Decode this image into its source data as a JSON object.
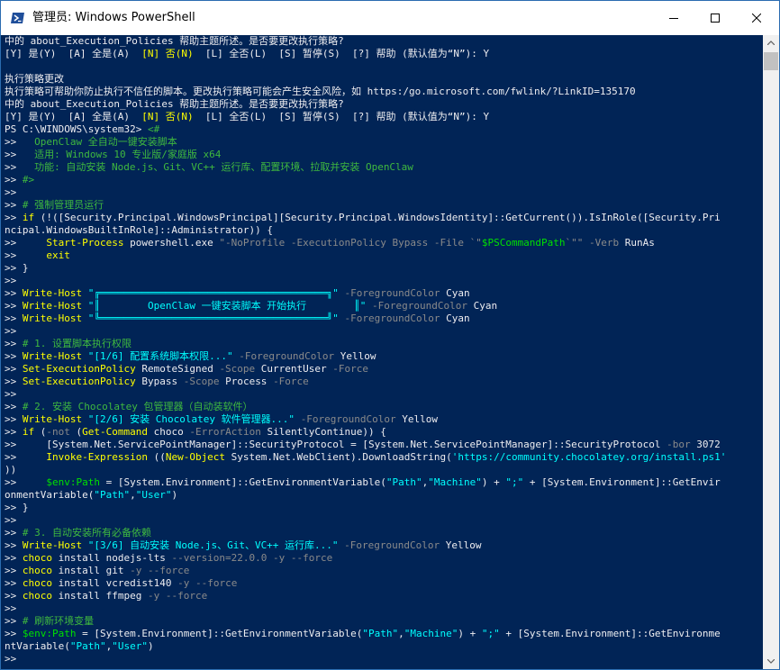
{
  "window": {
    "title": "管理员: Windows PowerShell",
    "app_icon": "powershell-icon",
    "buttons": [
      "minimize-icon",
      "maximize-icon",
      "close-icon"
    ]
  },
  "colors": {
    "console_bg": "#012456",
    "text": "#eeedf0",
    "cmdlet": "#ffff00",
    "comment": "#3fb93f",
    "param": "#8a8a8a",
    "string": "#00ffff",
    "variable": "#00e000"
  },
  "console": {
    "lines": [
      [
        [
          "w",
          "中的 about_Execution_Policies 帮助主题所述。是否要更改执行策略?"
        ]
      ],
      [
        [
          "w",
          "[Y] 是(Y)  [A] 全是(A)  "
        ],
        [
          "y",
          "[N] 否(N)"
        ],
        [
          "w",
          "  [L] 全否(L)  [S] 暂停(S)  [?] 帮助 (默认值为“N”): Y"
        ]
      ],
      [],
      [
        [
          "w",
          "执行策略更改"
        ]
      ],
      [
        [
          "w",
          "执行策略可帮助你防止执行不信任的脚本。更改执行策略可能会产生安全风险，如 https:/go.microsoft.com/fwlink/?LinkID=135170"
        ]
      ],
      [
        [
          "w",
          "中的 about_Execution_Policies 帮助主题所述。是否要更改执行策略?"
        ]
      ],
      [
        [
          "w",
          "[Y] 是(Y)  [A] 全是(A)  "
        ],
        [
          "y",
          "[N] 否(N)"
        ],
        [
          "w",
          "  [L] 全否(L)  [S] 暂停(S)  [?] 帮助 (默认值为“N”): Y"
        ]
      ],
      [
        [
          "w",
          "PS C:\\WINDOWS\\system32> "
        ],
        [
          "g",
          "<#"
        ]
      ],
      [
        [
          "w",
          ">> "
        ],
        [
          "g",
          "  OpenClaw 全自动一键安装脚本"
        ]
      ],
      [
        [
          "w",
          ">> "
        ],
        [
          "g",
          "  适用: Windows 10 专业版/家庭版 x64"
        ]
      ],
      [
        [
          "w",
          ">> "
        ],
        [
          "g",
          "  功能: 自动安装 Node.js、Git、VC++ 运行库、配置环境、拉取并安装 OpenClaw"
        ]
      ],
      [
        [
          "w",
          ">> "
        ],
        [
          "g",
          "#>"
        ]
      ],
      [
        [
          "w",
          ">>"
        ]
      ],
      [
        [
          "w",
          ">> "
        ],
        [
          "g",
          "# 强制管理员运行"
        ]
      ],
      [
        [
          "w",
          ">> "
        ],
        [
          "y",
          "if"
        ],
        [
          "w",
          " (!([Security.Principal.WindowsPrincipal][Security.Principal.WindowsIdentity]::GetCurrent()).IsInRole([Security.Pri"
        ]
      ],
      [
        [
          "w",
          "ncipal.WindowsBuiltInRole]::Administrator)) {"
        ]
      ],
      [
        [
          "w",
          ">>     "
        ],
        [
          "y",
          "Start-Process"
        ],
        [
          "w",
          " powershell.exe "
        ],
        [
          "gr",
          "\"-NoProfile -ExecutionPolicy Bypass -File `\""
        ],
        [
          "gn",
          "$PSCommandPath"
        ],
        [
          "gr",
          "`\"\""
        ],
        [
          "w",
          " "
        ],
        [
          "gr",
          "-Verb"
        ],
        [
          "w",
          " RunAs"
        ]
      ],
      [
        [
          "w",
          ">>     "
        ],
        [
          "y",
          "exit"
        ]
      ],
      [
        [
          "w",
          ">> }"
        ]
      ],
      [
        [
          "w",
          ">>"
        ]
      ],
      [
        [
          "w",
          ">> "
        ],
        [
          "y",
          "Write-Host"
        ],
        [
          "w",
          " "
        ],
        [
          "c",
          "\"╔══════════════════════════════════════╗\""
        ],
        [
          "w",
          " "
        ],
        [
          "gr",
          "-ForegroundColor"
        ],
        [
          "w",
          " Cyan"
        ]
      ],
      [
        [
          "w",
          ">> "
        ],
        [
          "y",
          "Write-Host"
        ],
        [
          "w",
          " "
        ],
        [
          "c",
          "\"║        OpenClaw 一键安装脚本 开始执行        ║\""
        ],
        [
          "w",
          " "
        ],
        [
          "gr",
          "-ForegroundColor"
        ],
        [
          "w",
          " Cyan"
        ]
      ],
      [
        [
          "w",
          ">> "
        ],
        [
          "y",
          "Write-Host"
        ],
        [
          "w",
          " "
        ],
        [
          "c",
          "\"╚══════════════════════════════════════╝\""
        ],
        [
          "w",
          " "
        ],
        [
          "gr",
          "-ForegroundColor"
        ],
        [
          "w",
          " Cyan"
        ]
      ],
      [
        [
          "w",
          ">>"
        ]
      ],
      [
        [
          "w",
          ">> "
        ],
        [
          "g",
          "# 1. 设置脚本执行权限"
        ]
      ],
      [
        [
          "w",
          ">> "
        ],
        [
          "y",
          "Write-Host"
        ],
        [
          "w",
          " "
        ],
        [
          "c",
          "\"[1/6] 配置系统脚本权限...\""
        ],
        [
          "w",
          " "
        ],
        [
          "gr",
          "-ForegroundColor"
        ],
        [
          "w",
          " Yellow"
        ]
      ],
      [
        [
          "w",
          ">> "
        ],
        [
          "y",
          "Set-ExecutionPolicy"
        ],
        [
          "w",
          " RemoteSigned "
        ],
        [
          "gr",
          "-Scope"
        ],
        [
          "w",
          " CurrentUser "
        ],
        [
          "gr",
          "-Force"
        ]
      ],
      [
        [
          "w",
          ">> "
        ],
        [
          "y",
          "Set-ExecutionPolicy"
        ],
        [
          "w",
          " Bypass "
        ],
        [
          "gr",
          "-Scope"
        ],
        [
          "w",
          " Process "
        ],
        [
          "gr",
          "-Force"
        ]
      ],
      [
        [
          "w",
          ">>"
        ]
      ],
      [
        [
          "w",
          ">> "
        ],
        [
          "g",
          "# 2. 安装 Chocolatey 包管理器（自动装软件）"
        ]
      ],
      [
        [
          "w",
          ">> "
        ],
        [
          "y",
          "Write-Host"
        ],
        [
          "w",
          " "
        ],
        [
          "c",
          "\"[2/6] 安装 Chocolatey 软件管理器...\""
        ],
        [
          "w",
          " "
        ],
        [
          "gr",
          "-ForegroundColor"
        ],
        [
          "w",
          " Yellow"
        ]
      ],
      [
        [
          "w",
          ">> "
        ],
        [
          "y",
          "if"
        ],
        [
          "w",
          " ("
        ],
        [
          "gr",
          "-not"
        ],
        [
          "w",
          " ("
        ],
        [
          "y",
          "Get-Command"
        ],
        [
          "w",
          " choco "
        ],
        [
          "gr",
          "-ErrorAction"
        ],
        [
          "w",
          " SilentlyContinue)) {"
        ]
      ],
      [
        [
          "w",
          ">>     [System.Net.ServicePointManager]::SecurityProtocol = [System.Net.ServicePointManager]::SecurityProtocol "
        ],
        [
          "gr",
          "-bor"
        ],
        [
          "w",
          " 3072"
        ]
      ],
      [
        [
          "w",
          ">>     "
        ],
        [
          "y",
          "Invoke-Expression"
        ],
        [
          "w",
          " (("
        ],
        [
          "y",
          "New-Object"
        ],
        [
          "w",
          " System.Net.WebClient).DownloadString("
        ],
        [
          "c",
          "'https://community.chocolatey.org/install.ps1'"
        ]
      ],
      [
        [
          "w",
          "))"
        ]
      ],
      [
        [
          "w",
          ">>     "
        ],
        [
          "gn",
          "$env:Path"
        ],
        [
          "w",
          " = [System.Environment]::GetEnvironmentVariable("
        ],
        [
          "c",
          "\"Path\""
        ],
        [
          "w",
          ","
        ],
        [
          "c",
          "\"Machine\""
        ],
        [
          "w",
          ") + "
        ],
        [
          "c",
          "\";\""
        ],
        [
          "w",
          " + [System.Environment]::GetEnvir"
        ]
      ],
      [
        [
          "w",
          "onmentVariable("
        ],
        [
          "c",
          "\"Path\""
        ],
        [
          "w",
          ","
        ],
        [
          "c",
          "\"User\""
        ],
        [
          "w",
          ")"
        ]
      ],
      [
        [
          "w",
          ">> }"
        ]
      ],
      [
        [
          "w",
          ">>"
        ]
      ],
      [
        [
          "w",
          ">> "
        ],
        [
          "g",
          "# 3. 自动安装所有必备依赖"
        ]
      ],
      [
        [
          "w",
          ">> "
        ],
        [
          "y",
          "Write-Host"
        ],
        [
          "w",
          " "
        ],
        [
          "c",
          "\"[3/6] 自动安装 Node.js、Git、VC++ 运行库...\""
        ],
        [
          "w",
          " "
        ],
        [
          "gr",
          "-ForegroundColor"
        ],
        [
          "w",
          " Yellow"
        ]
      ],
      [
        [
          "w",
          ">> "
        ],
        [
          "y",
          "choco"
        ],
        [
          "w",
          " install nodejs-lts "
        ],
        [
          "gr",
          "--version=22.0.0"
        ],
        [
          "w",
          " "
        ],
        [
          "gr",
          "-y"
        ],
        [
          "w",
          " "
        ],
        [
          "gr",
          "--force"
        ]
      ],
      [
        [
          "w",
          ">> "
        ],
        [
          "y",
          "choco"
        ],
        [
          "w",
          " install git "
        ],
        [
          "gr",
          "-y"
        ],
        [
          "w",
          " "
        ],
        [
          "gr",
          "--force"
        ]
      ],
      [
        [
          "w",
          ">> "
        ],
        [
          "y",
          "choco"
        ],
        [
          "w",
          " install vcredist140 "
        ],
        [
          "gr",
          "-y"
        ],
        [
          "w",
          " "
        ],
        [
          "gr",
          "--force"
        ]
      ],
      [
        [
          "w",
          ">> "
        ],
        [
          "y",
          "choco"
        ],
        [
          "w",
          " install ffmpeg "
        ],
        [
          "gr",
          "-y"
        ],
        [
          "w",
          " "
        ],
        [
          "gr",
          "--force"
        ]
      ],
      [
        [
          "w",
          ">>"
        ]
      ],
      [
        [
          "w",
          ">> "
        ],
        [
          "g",
          "# 刷新环境变量"
        ]
      ],
      [
        [
          "w",
          ">> "
        ],
        [
          "gn",
          "$env:Path"
        ],
        [
          "w",
          " = [System.Environment]::GetEnvironmentVariable("
        ],
        [
          "c",
          "\"Path\""
        ],
        [
          "w",
          ","
        ],
        [
          "c",
          "\"Machine\""
        ],
        [
          "w",
          ") + "
        ],
        [
          "c",
          "\";\""
        ],
        [
          "w",
          " + [System.Environment]::GetEnvironme"
        ]
      ],
      [
        [
          "w",
          "ntVariable("
        ],
        [
          "c",
          "\"Path\""
        ],
        [
          "w",
          ","
        ],
        [
          "c",
          "\"User\""
        ],
        [
          "w",
          ")"
        ]
      ],
      [
        [
          "w",
          ">>"
        ]
      ]
    ]
  },
  "scrollbar": {
    "up_icon": "scroll-up-arrow-icon",
    "down_icon": "scroll-down-arrow-icon"
  }
}
